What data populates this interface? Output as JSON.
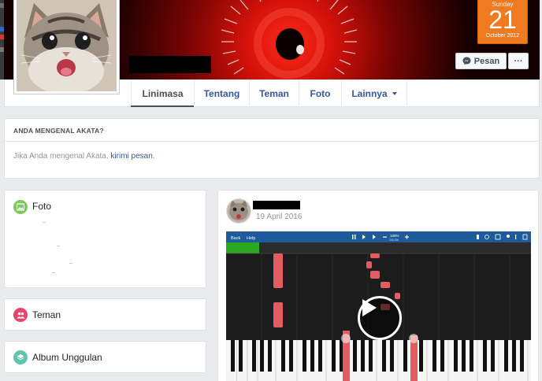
{
  "page": {
    "name": "Akata"
  },
  "calendar": {
    "day_label": "Sunday",
    "day_number": "21",
    "month_year": "October 2012"
  },
  "actions": {
    "message_label": "Pesan",
    "more_label": "···"
  },
  "tabs": [
    {
      "label": "Linimasa",
      "active": true
    },
    {
      "label": "Tentang",
      "active": false
    },
    {
      "label": "Teman",
      "active": false
    },
    {
      "label": "Foto",
      "active": false
    },
    {
      "label": "Lainnya",
      "active": false,
      "has_dropdown": true
    }
  ],
  "know_card": {
    "heading": "ANDA MENGENAL AKATA?",
    "text_before": "Jika Anda mengenal Akata, ",
    "link": "kirimi pesan",
    "text_after": "."
  },
  "sidebar": {
    "photos": {
      "title": "Foto",
      "icon": "photo-icon",
      "color": "#7ec960"
    },
    "friends": {
      "title": "Teman",
      "icon": "friends-icon",
      "color": "#e9446a"
    },
    "featured": {
      "title": "Album Unggulan",
      "icon": "layers-icon",
      "color": "#5ec4b0"
    }
  },
  "post": {
    "date": "19 April 2016",
    "video_app": {
      "menu_back": "Back",
      "menu_help": "Help",
      "zoom_top": "100%",
      "zoom_bottom": "100.0%"
    }
  }
}
